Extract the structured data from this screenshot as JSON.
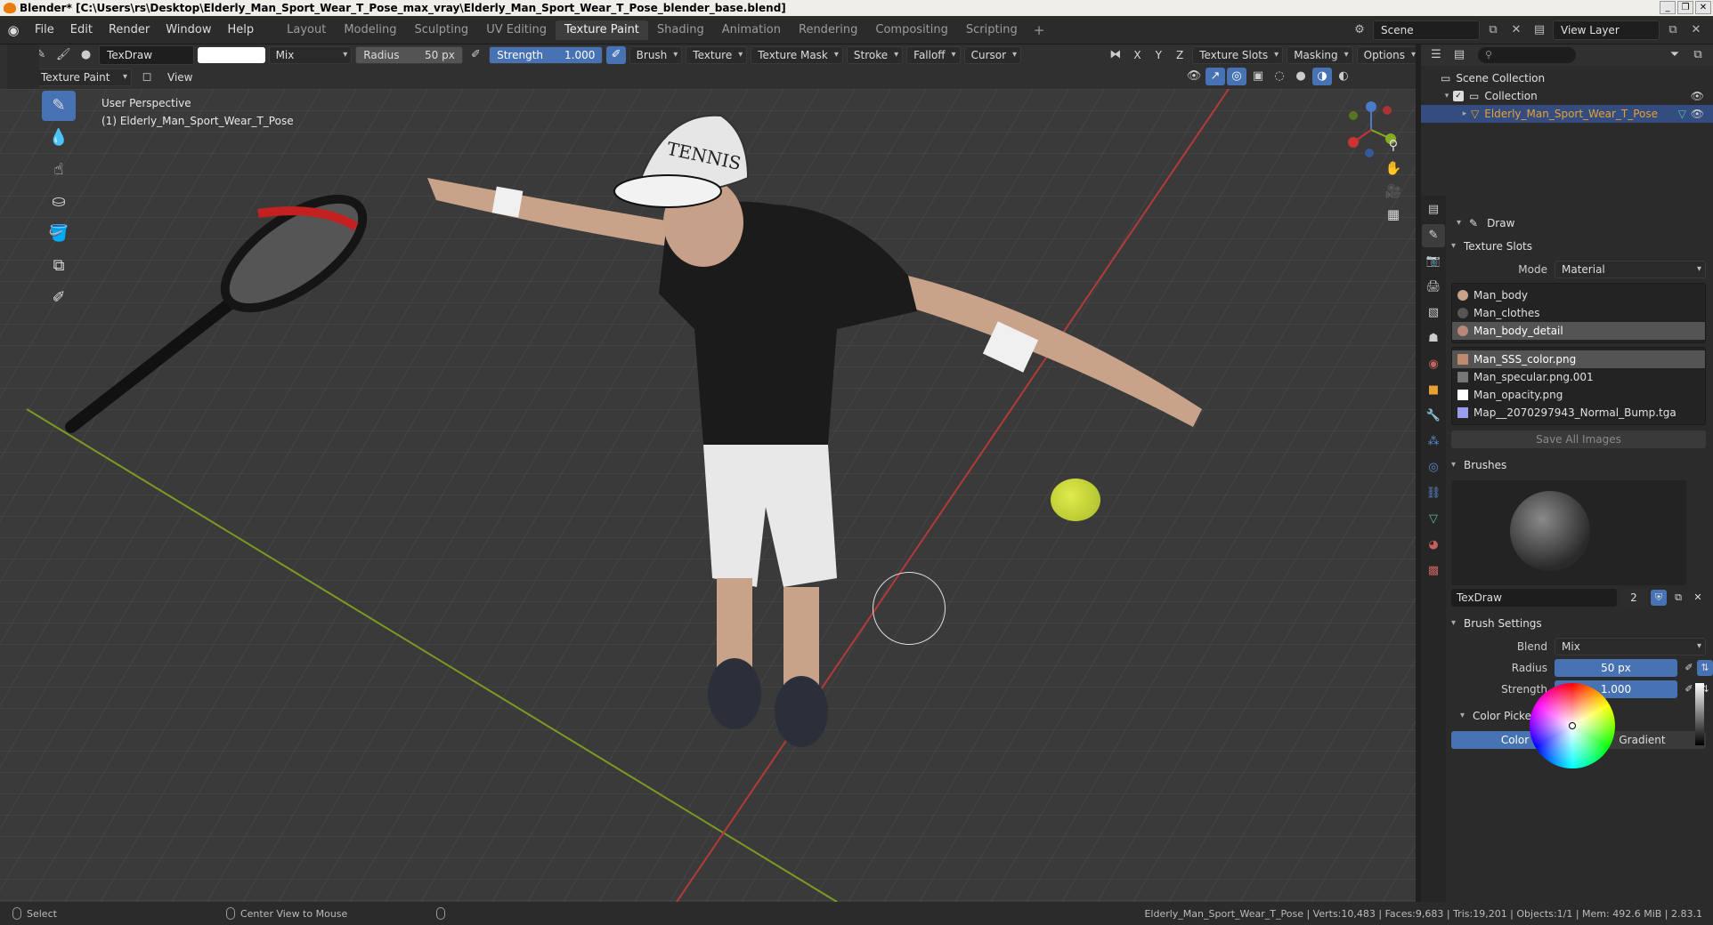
{
  "window": {
    "title": "Blender* [C:\\Users\\rs\\Desktop\\Elderly_Man_Sport_Wear_T_Pose_max_vray\\Elderly_Man_Sport_Wear_T_Pose_blender_base.blend]",
    "controls": [
      "_",
      "❐",
      "✕"
    ]
  },
  "menu": [
    "File",
    "Edit",
    "Render",
    "Window",
    "Help"
  ],
  "workspaces": [
    {
      "label": "Layout",
      "active": false
    },
    {
      "label": "Modeling",
      "active": false
    },
    {
      "label": "Sculpting",
      "active": false
    },
    {
      "label": "UV Editing",
      "active": false
    },
    {
      "label": "Texture Paint",
      "active": true
    },
    {
      "label": "Shading",
      "active": false
    },
    {
      "label": "Animation",
      "active": false
    },
    {
      "label": "Rendering",
      "active": false
    },
    {
      "label": "Compositing",
      "active": false
    },
    {
      "label": "Scripting",
      "active": false
    }
  ],
  "workspace_add": "+",
  "scene": {
    "label": "Scene",
    "view_layer": "View Layer"
  },
  "tool_header": {
    "brush_name": "TexDraw",
    "blend_mode": "Mix",
    "radius_label": "Radius",
    "radius_value": "50 px",
    "strength_label": "Strength",
    "strength_value": "1.000",
    "menus": [
      "Brush",
      "Texture",
      "Texture Mask",
      "Stroke",
      "Falloff",
      "Cursor"
    ],
    "axis": [
      "X",
      "Y",
      "Z"
    ],
    "right_menus": [
      "Texture Slots",
      "Masking",
      "Options"
    ]
  },
  "viewport_header": {
    "mode": "Texture Paint",
    "view": "View"
  },
  "viewport": {
    "perspective": "User Perspective",
    "object": "(1) Elderly_Man_Sport_Wear_T_Pose",
    "cap_text": "TENNIS"
  },
  "outliner": {
    "scene_collection": "Scene Collection",
    "collection": "Collection",
    "object": "Elderly_Man_Sport_Wear_T_Pose"
  },
  "properties": {
    "tool_name": "Draw",
    "texture_slots_title": "Texture Slots",
    "mode_label": "Mode",
    "mode_value": "Material",
    "materials": [
      {
        "name": "Man_body",
        "selected": false,
        "color": "#c9a28a"
      },
      {
        "name": "Man_clothes",
        "selected": false,
        "color": "#555555"
      },
      {
        "name": "Man_body_detail",
        "selected": true,
        "color": "#b98878"
      }
    ],
    "images": [
      {
        "name": "Man_SSS_color.png",
        "selected": true,
        "color": "#c08a70"
      },
      {
        "name": "Man_specular.png.001",
        "selected": false,
        "color": "#777777"
      },
      {
        "name": "Man_opacity.png",
        "selected": false,
        "color": "#ffffff"
      },
      {
        "name": "Map__2070297943_Normal_Bump.tga",
        "selected": false,
        "color": "#9a9cf0"
      }
    ],
    "save_all": "Save All Images",
    "brushes_title": "Brushes",
    "brush_name": "TexDraw",
    "brush_users": "2",
    "brush_settings_title": "Brush Settings",
    "blend_label": "Blend",
    "blend_value": "Mix",
    "radius_label": "Radius",
    "radius_value": "50 px",
    "strength_label": "Strength",
    "strength_value": "1.000",
    "color_picker_title": "Color Picker",
    "color_tab": "Color",
    "gradient_tab": "Gradient"
  },
  "status": {
    "select": "Select",
    "center_view": "Center View to Mouse",
    "stats": "Elderly_Man_Sport_Wear_T_Pose | Verts:10,483 | Faces:9,683 | Tris:19,201 | Objects:1/1 | Mem: 492.6 MiB | 2.83.1"
  },
  "colors": {
    "accent": "#4772b3",
    "bg": "#3a3a3a",
    "panel": "#2b2b2b",
    "x_axis": "#cc3333",
    "y_axis": "#88aa22"
  }
}
